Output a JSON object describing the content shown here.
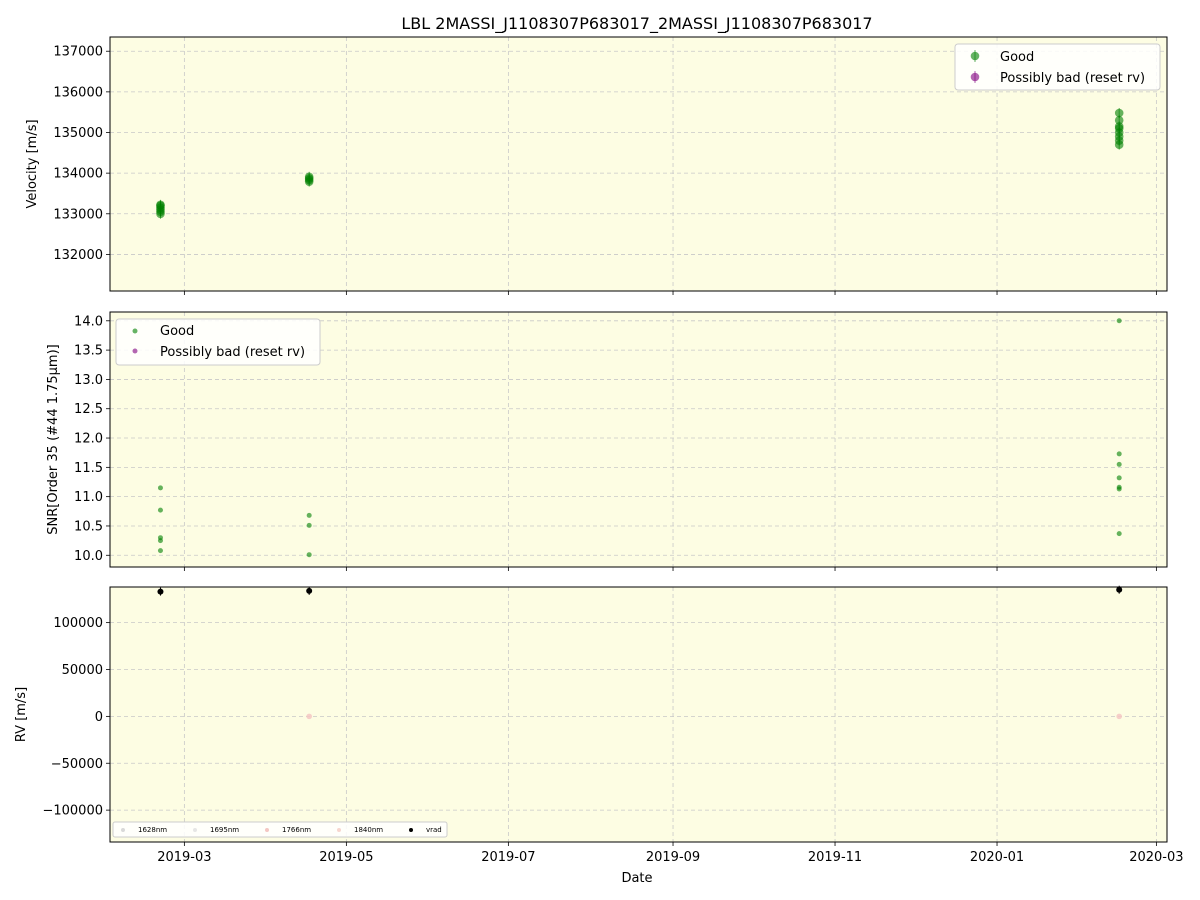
{
  "title": "LBL 2MASSI_J1108307P683017_2MASSI_J1108307P683017",
  "xlabel": "Date",
  "colors": {
    "background": "#fdfde3",
    "good": "#008000",
    "bad": "#800080",
    "grid": "#c8c8c8",
    "band_1628": "#d9d9d9",
    "band_1695": "#e6e6e6",
    "band_1766": "#f4c7c3",
    "band_1840": "#f7d6cf",
    "vrad": "#000000"
  },
  "x_ticks": [
    "2019-03",
    "2019-05",
    "2019-07",
    "2019-09",
    "2019-11",
    "2020-01",
    "2020-03"
  ],
  "x_range": [
    "2019-02-01",
    "2020-03-05"
  ],
  "chart_data": [
    {
      "type": "scatter",
      "ylabel": "Velocity [m/s]",
      "ylim": [
        131100,
        137350
      ],
      "y_ticks": [
        "132000",
        "133000",
        "134000",
        "135000",
        "136000",
        "137000"
      ],
      "grid": true,
      "legend_placement": "upper-right",
      "legend": [
        "Good",
        "Possibly bad (reset rv)"
      ],
      "series": [
        {
          "name": "Good",
          "points": [
            [
              "2019-02-20",
              133000
            ],
            [
              "2019-02-20",
              133050
            ],
            [
              "2019-02-20",
              133100
            ],
            [
              "2019-02-20",
              133150
            ],
            [
              "2019-02-20",
              133200
            ],
            [
              "2019-02-20",
              133220
            ],
            [
              "2019-04-17",
              133790
            ],
            [
              "2019-04-17",
              133830
            ],
            [
              "2019-04-17",
              133870
            ],
            [
              "2019-04-17",
              133910
            ],
            [
              "2020-02-16",
              134700
            ],
            [
              "2020-02-16",
              134800
            ],
            [
              "2020-02-16",
              134900
            ],
            [
              "2020-02-16",
              135000
            ],
            [
              "2020-02-16",
              135100
            ],
            [
              "2020-02-16",
              135150
            ],
            [
              "2020-02-16",
              135300
            ],
            [
              "2020-02-16",
              135480
            ]
          ]
        },
        {
          "name": "Possibly bad (reset rv)",
          "points": []
        }
      ]
    },
    {
      "type": "scatter",
      "ylabel": "SNR[Order 35 (#44 1.75μm)]",
      "ylim": [
        9.8,
        14.15
      ],
      "y_ticks": [
        "10.0",
        "10.5",
        "11.0",
        "11.5",
        "12.0",
        "12.5",
        "13.0",
        "13.5",
        "14.0"
      ],
      "grid": true,
      "legend_placement": "upper-left",
      "legend": [
        "Good",
        "Possibly bad (reset rv)"
      ],
      "series": [
        {
          "name": "Good",
          "points": [
            [
              "2019-02-20",
              11.15
            ],
            [
              "2019-02-20",
              10.77
            ],
            [
              "2019-02-20",
              10.3
            ],
            [
              "2019-02-20",
              10.25
            ],
            [
              "2019-02-20",
              10.08
            ],
            [
              "2019-04-17",
              10.68
            ],
            [
              "2019-04-17",
              10.51
            ],
            [
              "2019-04-17",
              10.01
            ],
            [
              "2020-02-16",
              14.0
            ],
            [
              "2020-02-16",
              11.73
            ],
            [
              "2020-02-16",
              11.55
            ],
            [
              "2020-02-16",
              11.32
            ],
            [
              "2020-02-16",
              11.16
            ],
            [
              "2020-02-16",
              11.13
            ],
            [
              "2020-02-16",
              10.37
            ]
          ]
        },
        {
          "name": "Possibly bad (reset rv)",
          "points": []
        }
      ]
    },
    {
      "type": "scatter",
      "ylabel": "RV [m/s]",
      "ylim": [
        -134000,
        138000
      ],
      "y_ticks": [
        "−100000",
        "−50000",
        "0",
        "50000",
        "100000"
      ],
      "y_tick_values": [
        -100000,
        -50000,
        0,
        50000,
        100000
      ],
      "grid": true,
      "legend_placement": "lower-left",
      "legend": [
        "1628nm",
        "1695nm",
        "1766nm",
        "1840nm",
        "vrad"
      ],
      "series": [
        {
          "name": "1766nm",
          "points": [
            [
              "2019-04-17",
              0
            ],
            [
              "2020-02-16",
              0
            ]
          ]
        },
        {
          "name": "vrad",
          "points": [
            [
              "2019-02-20",
              133100
            ],
            [
              "2019-04-17",
              133850
            ],
            [
              "2020-02-16",
              135100
            ]
          ]
        }
      ]
    }
  ]
}
